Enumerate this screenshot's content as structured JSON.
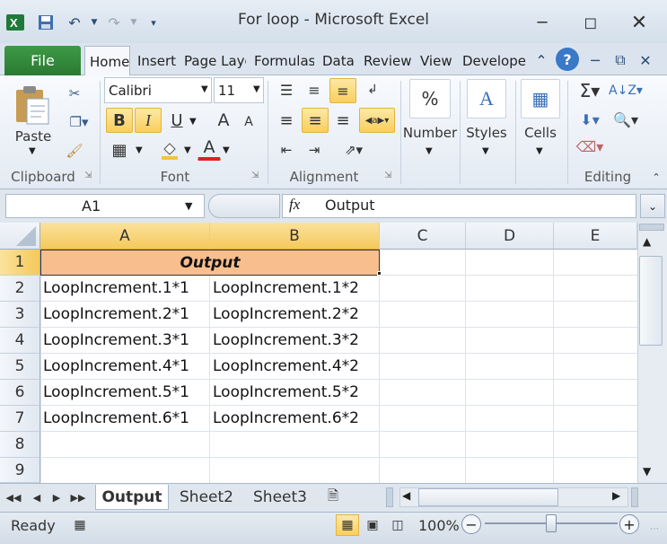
{
  "window": {
    "title": "For loop  -  Microsoft Excel",
    "qat_icons": [
      "excel-logo-icon",
      "save-icon",
      "undo-icon",
      "redo-icon",
      "customize-qat-icon"
    ],
    "controls": [
      "minimize-icon",
      "restore-icon",
      "close-icon"
    ]
  },
  "ribbon": {
    "file_label": "File",
    "tabs": [
      "Home",
      "Insert",
      "Page Layout",
      "Formulas",
      "Data",
      "Review",
      "View",
      "Developer"
    ],
    "active_tab": "Home",
    "clipboard": {
      "paste_label": "Paste",
      "group_label": "Clipboard"
    },
    "font": {
      "name": "Calibri",
      "size": "11",
      "bold": "B",
      "italic": "I",
      "underline": "U",
      "grow": "A",
      "shrink": "A",
      "font_color": "A",
      "group_label": "Font"
    },
    "alignment": {
      "group_label": "Alignment"
    },
    "number": {
      "label": "Number",
      "symbol": "%"
    },
    "styles": {
      "label": "Styles"
    },
    "cells": {
      "label": "Cells"
    },
    "editing": {
      "group_label": "Editing"
    },
    "accent": "#2a7a32",
    "active_highlight": "#f9cf5c"
  },
  "formula_bar": {
    "name_box": "A1",
    "fx": "fx",
    "formula": "Output"
  },
  "sheet": {
    "columns": [
      "A",
      "B",
      "C",
      "D",
      "E"
    ],
    "rows": [
      "1",
      "2",
      "3",
      "4",
      "5",
      "6",
      "7",
      "8",
      "9"
    ],
    "header_cell": "Output",
    "header_fill": "#f9be8e",
    "data": [
      [
        "LoopIncrement.1*1",
        "LoopIncrement.1*2"
      ],
      [
        "LoopIncrement.2*1",
        "LoopIncrement.2*2"
      ],
      [
        "LoopIncrement.3*1",
        "LoopIncrement.3*2"
      ],
      [
        "LoopIncrement.4*1",
        "LoopIncrement.4*2"
      ],
      [
        "LoopIncrement.5*1",
        "LoopIncrement.5*2"
      ],
      [
        "LoopIncrement.6*1",
        "LoopIncrement.6*2"
      ]
    ]
  },
  "sheet_tabs": [
    "Output",
    "Sheet2",
    "Sheet3"
  ],
  "active_sheet": "Output",
  "status": {
    "ready": "Ready",
    "zoom": "100%"
  }
}
